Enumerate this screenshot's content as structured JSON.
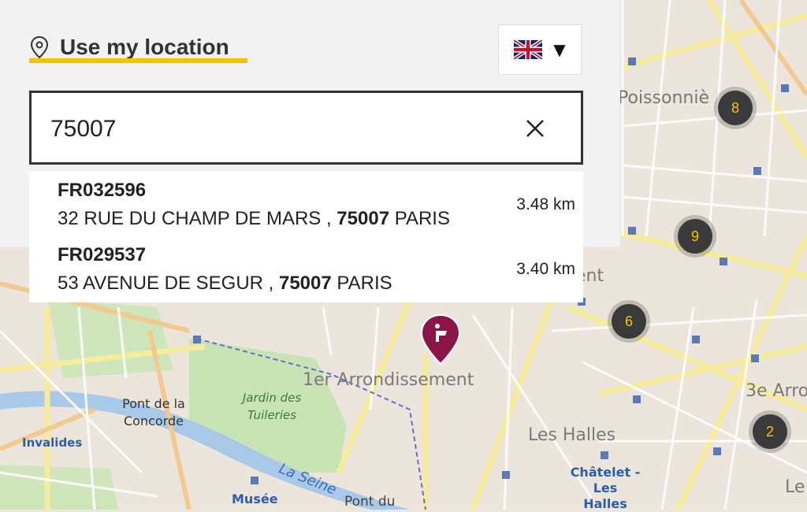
{
  "location": {
    "label": "Use my location",
    "icon": "map-pin-icon",
    "underline_color": "#f4c400"
  },
  "language": {
    "selected_flag": "uk-flag-icon",
    "caret": "▼"
  },
  "search": {
    "value": "75007",
    "clear_icon": "close-icon"
  },
  "results": [
    {
      "code": "FR032596",
      "street": "32 RUE DU CHAMP DE MARS ,",
      "postal": "75007",
      "city": "PARIS",
      "distance": "3.48 km"
    },
    {
      "code": "FR029537",
      "street": "53 AVENUE DE SEGUR ,",
      "postal": "75007",
      "city": "PARIS",
      "distance": "3.40 km"
    }
  ],
  "map": {
    "labels": {
      "poissonniere": "Poissonniè",
      "arrondissement": "1er Arrondissement",
      "third": "3e Arro",
      "halles": "Les Halles",
      "chatelet": "Châtelet - Les Halles",
      "pont_concorde": "Pont de la Concorde",
      "jardin": "Jardin des Tuileries",
      "invalides": "Invalides",
      "musee": "Musée",
      "pont_du": "Pont du",
      "seine": "La Seine",
      "le": "Le",
      "ent": "ent"
    },
    "clusters": [
      "8",
      "9",
      "6",
      "2"
    ],
    "cluster_text_color": "#f4c400",
    "pin_color": "#8c1547"
  }
}
